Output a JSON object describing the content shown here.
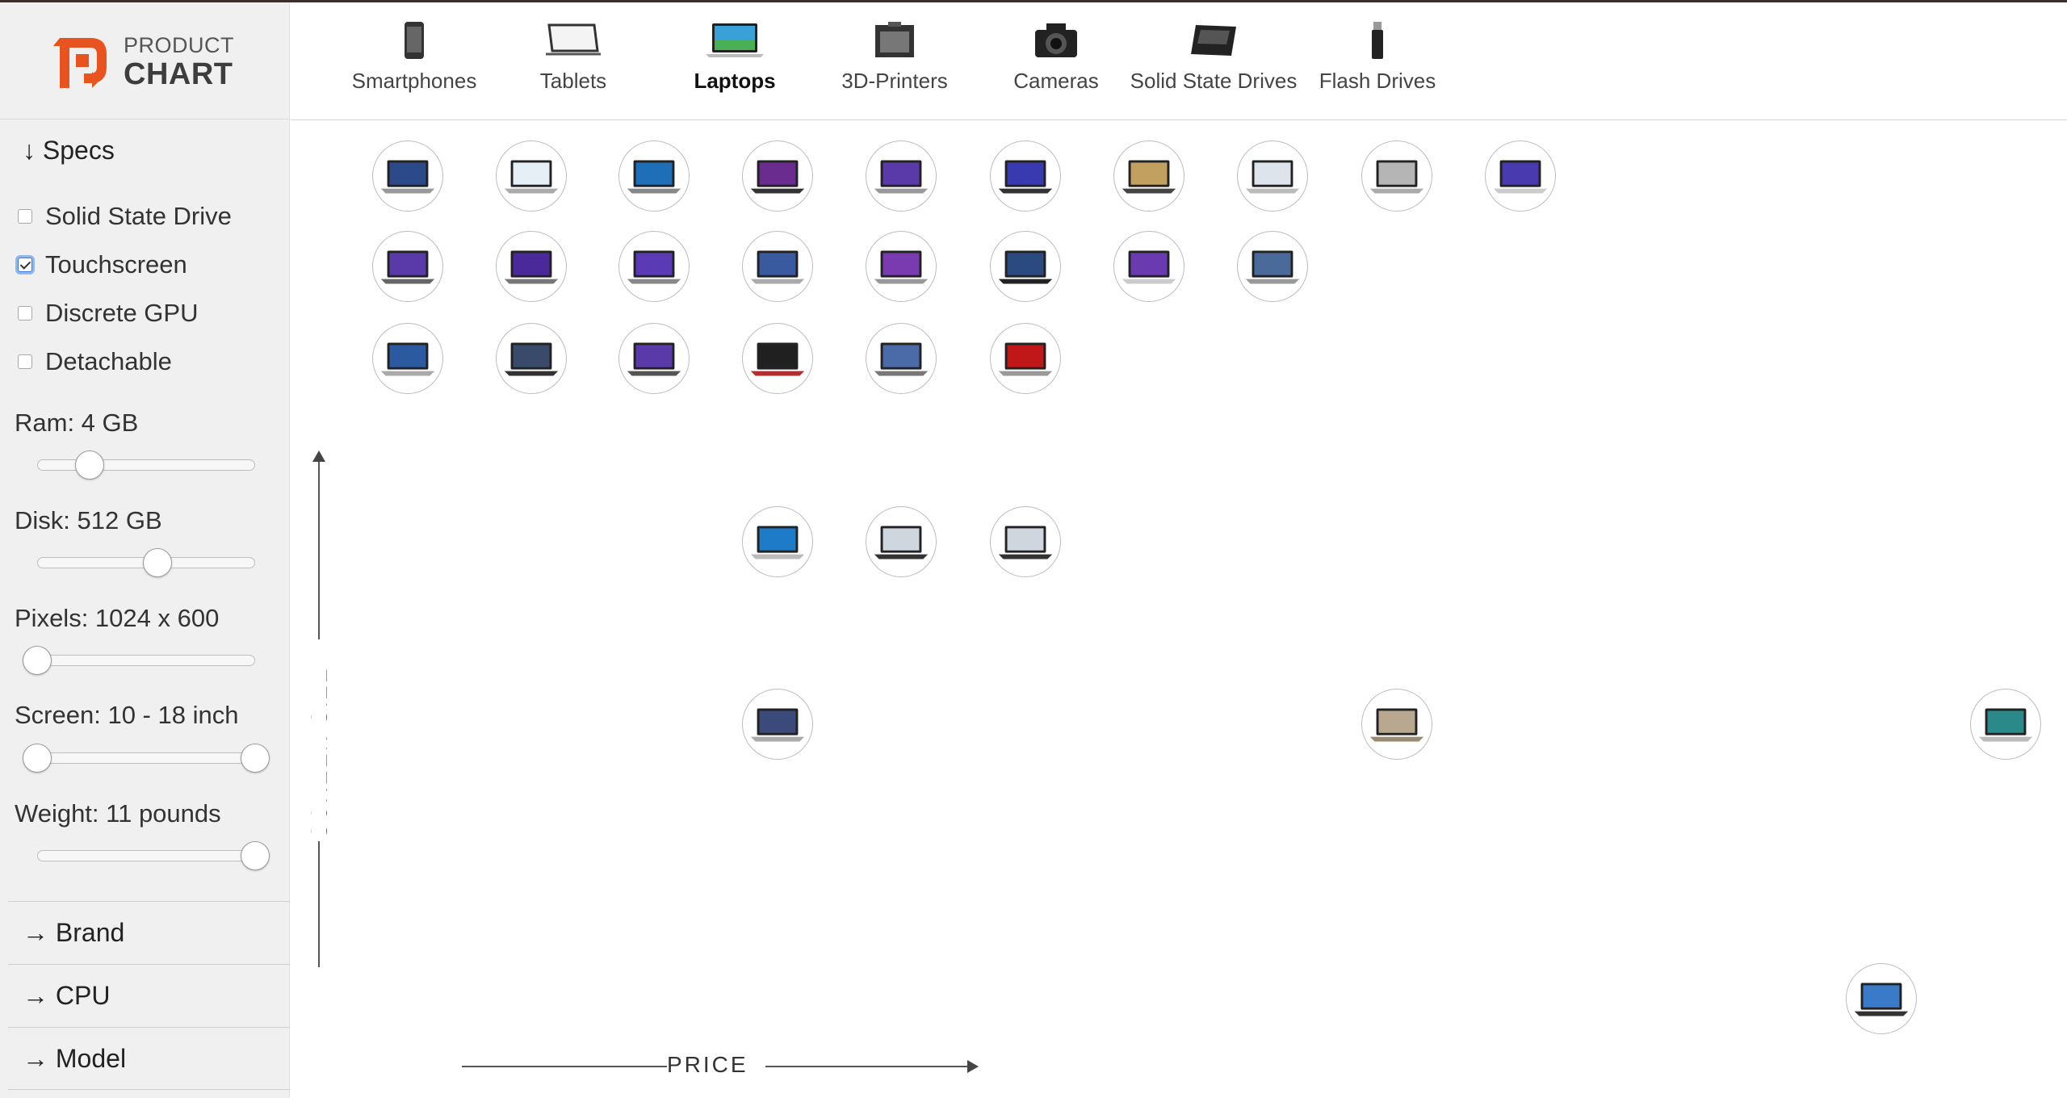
{
  "app": {
    "logo_line1": "PRODUCT",
    "logo_line2": "CHART",
    "brand_color": "#e8541f"
  },
  "nav": [
    {
      "label": "Smartphones",
      "icon": "smartphone-icon",
      "active": false
    },
    {
      "label": "Tablets",
      "icon": "tablet-icon",
      "active": false
    },
    {
      "label": "Laptops",
      "icon": "laptop-icon",
      "active": true
    },
    {
      "label": "3D-Printers",
      "icon": "3d-printer-icon",
      "active": false
    },
    {
      "label": "Cameras",
      "icon": "camera-icon",
      "active": false
    },
    {
      "label": "Solid State Drives",
      "icon": "ssd-icon",
      "active": false
    },
    {
      "label": "Flash Drives",
      "icon": "flash-drive-icon",
      "active": false
    }
  ],
  "sidebar": {
    "specs_label": "↓ Specs",
    "checkboxes": [
      {
        "label": "Solid State Drive",
        "checked": false
      },
      {
        "label": "Touchscreen",
        "checked": true
      },
      {
        "label": "Discrete GPU",
        "checked": false
      },
      {
        "label": "Detachable",
        "checked": false
      }
    ],
    "sliders": [
      {
        "label": "Ram: 4 GB",
        "values": [
          0.24
        ]
      },
      {
        "label": "Disk: 512 GB",
        "values": [
          0.55
        ]
      },
      {
        "label": "Pixels: 1024 x 600",
        "values": [
          0.0
        ]
      },
      {
        "label": "Screen: 10 - 18 inch",
        "values": [
          0.0,
          1.0
        ]
      },
      {
        "label": "Weight: 11 pounds",
        "values": [
          1.0
        ]
      }
    ],
    "sections": [
      "→ Brand",
      "→ CPU",
      "→ Model"
    ]
  },
  "chart_data": {
    "type": "scatter",
    "xlabel": "PRICE",
    "ylabel": "SCREEN SIZE"
  },
  "icons": {
    "x_arrow": "arrow-right-icon",
    "y_arrow": "arrow-up-icon"
  }
}
